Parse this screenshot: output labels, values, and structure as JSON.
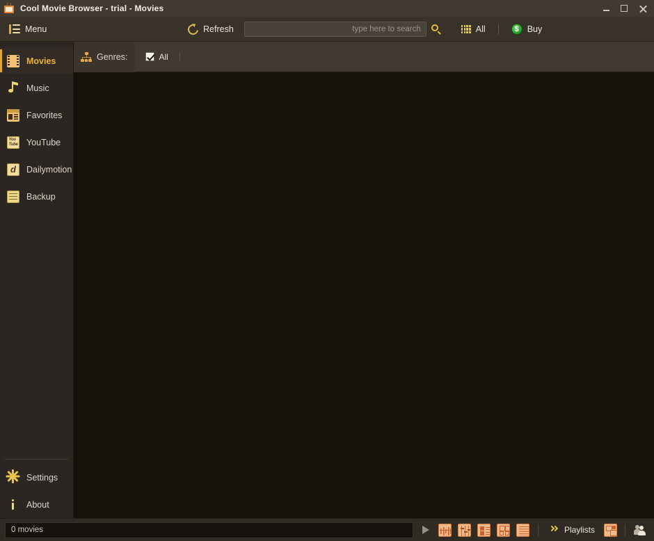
{
  "window": {
    "title": "Cool Movie Browser - trial - Movies",
    "app_icon": "tv-icon",
    "minimize_label": "Minimize",
    "maximize_label": "Maximize",
    "close_label": "Close"
  },
  "toolbar": {
    "menu_label": "Menu",
    "menu_icon": "hamburger-menu-icon",
    "refresh_label": "Refresh",
    "refresh_icon": "refresh-icon",
    "search_value": "",
    "search_placeholder": "type here to search",
    "search_icon": "magnifier-icon",
    "filter_label": "All",
    "filter_icon": "grid-dots-icon",
    "buy_label": "Buy",
    "buy_icon": "green-dollar-coin-icon"
  },
  "sidebar": {
    "items": [
      {
        "label": "Movies",
        "icon": "film-strip-icon",
        "active": true
      },
      {
        "label": "Music",
        "icon": "music-note-icon",
        "active": false
      },
      {
        "label": "Favorites",
        "icon": "favorites-card-icon",
        "active": false
      },
      {
        "label": "YouTube",
        "icon": "youtube-icon",
        "active": false
      },
      {
        "label": "Dailymotion",
        "icon": "dailymotion-icon",
        "active": false
      },
      {
        "label": "Backup",
        "icon": "backup-drive-icon",
        "active": false
      }
    ],
    "bottom_items": [
      {
        "label": "Settings",
        "icon": "gear-icon"
      },
      {
        "label": "About",
        "icon": "info-icon"
      }
    ]
  },
  "genres": {
    "label": "Genres:",
    "icon": "hierarchy-icon",
    "items": [
      {
        "label": "All",
        "checked": true
      }
    ]
  },
  "statusbar": {
    "count_text": "0 movies",
    "play_label": "Play",
    "play_icon": "play-icon",
    "views": [
      {
        "icon": "timeline-view-icon"
      },
      {
        "icon": "sliders-view-icon"
      },
      {
        "icon": "detail-list-view-icon"
      },
      {
        "icon": "grid-view-icon"
      },
      {
        "icon": "list-view-icon"
      }
    ],
    "playlists_label": "Playlists",
    "playlists_icon": "double-chevron-icon",
    "manage_playlists_icon": "manage-playlists-icon",
    "people_icon": "people-icon"
  },
  "colors": {
    "titlebar": "#403a33",
    "toolbar": "#393229",
    "sidebar": "#2b2621",
    "genres_bar": "#413a32",
    "canvas": "#17110c",
    "statusbar": "#2f2a24",
    "accent_gold": "#e8b33c",
    "accent_orange": "#e2863a",
    "tile_orange": "#f0b98c",
    "buy_green": "#2ba32b"
  }
}
